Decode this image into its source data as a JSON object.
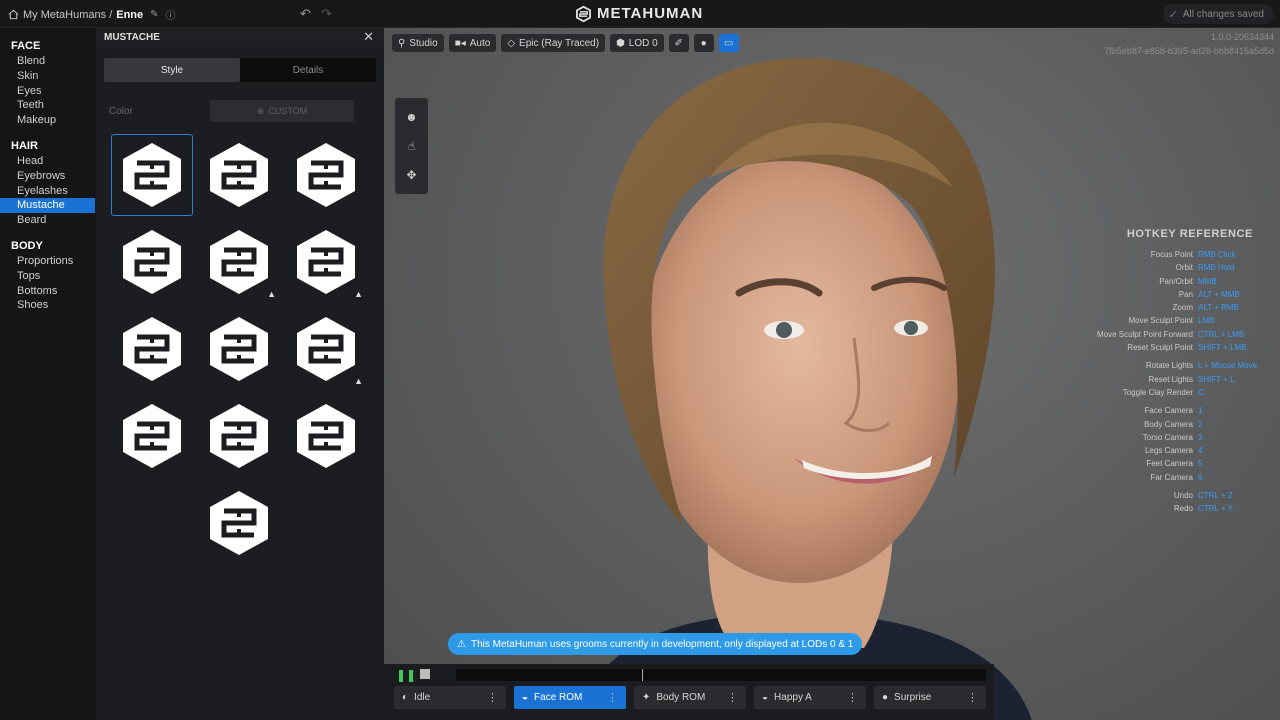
{
  "topbar": {
    "breadcrumb_root": "My MetaHumans /",
    "breadcrumb_name": "Enne",
    "logo": "METAHUMAN",
    "saved_status": "All changes saved"
  },
  "nav": {
    "face_label": "FACE",
    "face_items": [
      "Blend",
      "Skin",
      "Eyes",
      "Teeth",
      "Makeup"
    ],
    "hair_label": "HAIR",
    "hair_items": [
      "Head",
      "Eyebrows",
      "Eyelashes",
      "Mustache",
      "Beard"
    ],
    "body_label": "BODY",
    "body_items": [
      "Proportions",
      "Tops",
      "Bottoms",
      "Shoes"
    ],
    "active_item": "Mustache"
  },
  "panel": {
    "title": "MUSTACHE",
    "tabs": [
      "Style",
      "Details"
    ],
    "active_tab": "Style",
    "color_label": "Color",
    "custom_button": "CUSTOM",
    "tiles": [
      {
        "warning": false,
        "selected": true
      },
      {
        "warning": false,
        "selected": false
      },
      {
        "warning": false,
        "selected": false
      },
      {
        "warning": false,
        "selected": false
      },
      {
        "warning": true,
        "selected": false
      },
      {
        "warning": true,
        "selected": false
      },
      {
        "warning": false,
        "selected": false
      },
      {
        "warning": false,
        "selected": false
      },
      {
        "warning": true,
        "selected": false
      },
      {
        "warning": false,
        "selected": false
      },
      {
        "warning": false,
        "selected": false
      },
      {
        "warning": false,
        "selected": false
      },
      {
        "warning": false,
        "selected": false
      }
    ]
  },
  "viewport": {
    "toolbar": [
      "Studio",
      "Auto",
      "Epic (Ray Traced)",
      "LOD 0"
    ],
    "version": "1.0.0-20534344",
    "hash": "7fb5eb87-e858-b395-ad28-bbb8415a5d5d",
    "banner": "This MetaHuman uses grooms currently in development, only displayed at LODs 0 & 1"
  },
  "hotkeys": {
    "title": "HOTKEY REFERENCE",
    "groups": [
      [
        {
          "key": "Focus Point",
          "value": "RMB Click"
        },
        {
          "key": "Orbit",
          "value": "RMB Hold"
        },
        {
          "key": "Pan/Orbit",
          "value": "MMB"
        },
        {
          "key": "Pan",
          "value": "ALT + MMB"
        },
        {
          "key": "Zoom",
          "value": "ALT + RMB"
        },
        {
          "key": "Move Sculpt Point",
          "value": "LMB"
        },
        {
          "key": "Move Sculpt Point Forward",
          "value": "CTRL + LMB"
        },
        {
          "key": "Reset Sculpt Point",
          "value": "SHIFT + LMB"
        }
      ],
      [
        {
          "key": "Rotate Lights",
          "value": "L + Mouse Move"
        },
        {
          "key": "Reset Lights",
          "value": "SHIFT + L"
        },
        {
          "key": "Toggle Clay Render",
          "value": "C"
        }
      ],
      [
        {
          "key": "Face Camera",
          "value": "1"
        },
        {
          "key": "Body Camera",
          "value": "2"
        },
        {
          "key": "Torso Camera",
          "value": "3"
        },
        {
          "key": "Legs Camera",
          "value": "4"
        },
        {
          "key": "Feet Camera",
          "value": "5"
        },
        {
          "key": "Far Camera",
          "value": "6"
        }
      ],
      [
        {
          "key": "Undo",
          "value": "CTRL + Z"
        },
        {
          "key": "Redo",
          "value": "CTRL + Y"
        }
      ]
    ]
  },
  "animations": [
    {
      "label": "Idle",
      "active": false,
      "icon": "idle-icon"
    },
    {
      "label": "Face ROM",
      "active": true,
      "icon": "face-icon"
    },
    {
      "label": "Body ROM",
      "active": false,
      "icon": "body-icon"
    },
    {
      "label": "Happy A",
      "active": false,
      "icon": "face-icon"
    },
    {
      "label": "Surprise",
      "active": false,
      "icon": "head-icon"
    }
  ],
  "colors": {
    "accent": "#1a73d4",
    "banner": "#2e9be8",
    "hotkey_value": "#3a9bf5",
    "play": "#3ecb5a"
  }
}
